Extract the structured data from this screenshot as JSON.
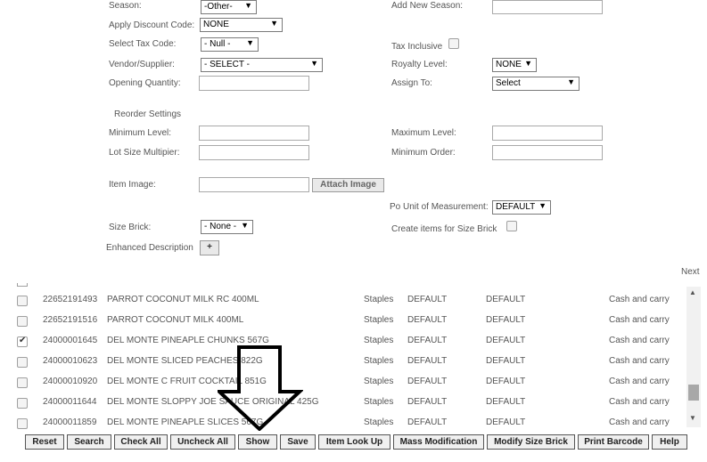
{
  "form": {
    "season_label": "Season:",
    "season_value": "-Other-",
    "add_new_season_label": "Add New Season:",
    "apply_discount_label": "Apply Discount Code:",
    "apply_discount_value": "NONE",
    "tax_code_label": "Select Tax Code:",
    "tax_code_value": "- Null -",
    "tax_inclusive_label": "Tax Inclusive",
    "vendor_label": "Vendor/Supplier:",
    "vendor_value": "- SELECT -",
    "royalty_label": "Royalty Level:",
    "royalty_value": "NONE",
    "opening_qty_label": "Opening Quantity:",
    "assign_to_label": "Assign To:",
    "assign_to_value": "Select",
    "reorder_heading": "Reorder Settings",
    "min_level_label": "Minimum Level:",
    "max_level_label": "Maximum Level:",
    "lot_size_label": "Lot Size Multipier:",
    "min_order_label": "Minimum Order:",
    "item_image_label": "Item Image:",
    "attach_image_label": "Attach Image",
    "po_uom_label": "Po Unit of Measurement:",
    "po_uom_value": "DEFAULT",
    "size_brick_label": "Size Brick:",
    "size_brick_value": "- None -",
    "create_items_label": "Create items for Size Brick",
    "enhanced_desc_label": "Enhanced Description",
    "enhanced_desc_plus": "+"
  },
  "list": {
    "next_label": "Next",
    "rows": [
      {
        "code": "22652191493",
        "name": "PARROT COCONUT MILK RC 400ML",
        "category": "Staples",
        "uom1": "DEFAULT",
        "uom2": "DEFAULT",
        "type": "Cash and carry",
        "checked": false
      },
      {
        "code": "22652191516",
        "name": "PARROT COCONUT MILK 400ML",
        "category": "Staples",
        "uom1": "DEFAULT",
        "uom2": "DEFAULT",
        "type": "Cash and carry",
        "checked": false
      },
      {
        "code": "24000001645",
        "name": "DEL MONTE PINEAPLE CHUNKS 567G",
        "category": "Staples",
        "uom1": "DEFAULT",
        "uom2": "DEFAULT",
        "type": "Cash and carry",
        "checked": true
      },
      {
        "code": "24000010623",
        "name": "DEL MONTE SLICED PEACHES 822G",
        "category": "Staples",
        "uom1": "DEFAULT",
        "uom2": "DEFAULT",
        "type": "Cash and carry",
        "checked": false
      },
      {
        "code": "24000010920",
        "name": "DEL MONTE C FRUIT COCKTAIL 851G",
        "category": "Staples",
        "uom1": "DEFAULT",
        "uom2": "DEFAULT",
        "type": "Cash and carry",
        "checked": false
      },
      {
        "code": "24000011644",
        "name": "DEL MONTE SLOPPY JOE SAUCE ORIGINAL 425G",
        "category": "Staples",
        "uom1": "DEFAULT",
        "uom2": "DEFAULT",
        "type": "Cash and carry",
        "checked": false
      },
      {
        "code": "24000011859",
        "name": "DEL MONTE PINEAPLE SLICES 567G",
        "category": "Staples",
        "uom1": "DEFAULT",
        "uom2": "DEFAULT",
        "type": "Cash and carry",
        "checked": false
      }
    ]
  },
  "toolbar": {
    "reset": "Reset",
    "search": "Search",
    "check_all": "Check All",
    "uncheck_all": "Uncheck All",
    "show": "Show",
    "save": "Save",
    "item_lookup": "Item Look Up",
    "mass_mod": "Mass Modification",
    "modify_size_brick": "Modify Size Brick",
    "print_barcode": "Print Barcode",
    "help": "Help"
  },
  "icons": {
    "dropdown": "chevron-down-icon",
    "scroll_up": "arrow-up-icon",
    "scroll_down": "arrow-down-icon",
    "annotation": "down-arrow-annotation-icon"
  },
  "colors": {
    "accent_border": "#a9a9a9",
    "annotation": "#000000"
  }
}
